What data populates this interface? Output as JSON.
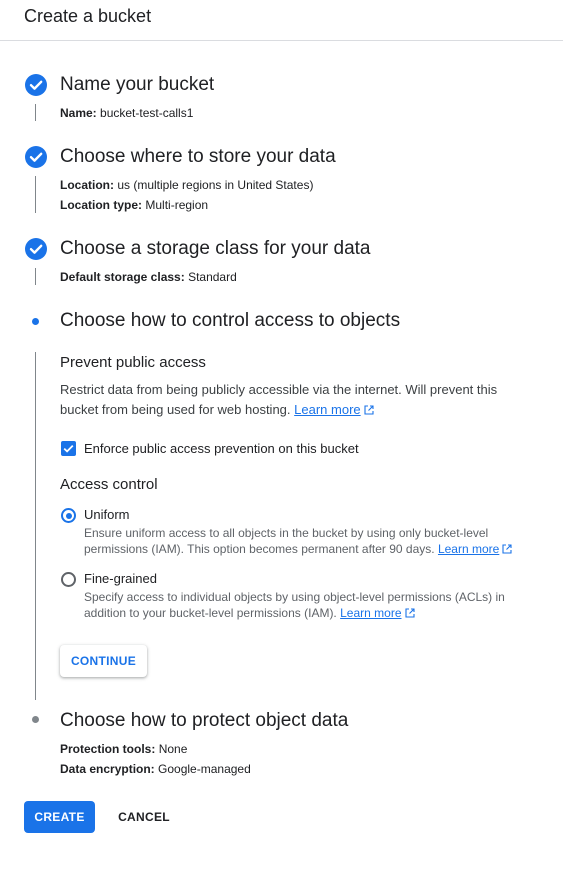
{
  "header": {
    "title": "Create a bucket"
  },
  "steps": [
    {
      "title": "Name your bucket",
      "status": "done",
      "details": [
        {
          "label": "Name:",
          "value": "bucket-test-calls1"
        }
      ]
    },
    {
      "title": "Choose where to store your data",
      "status": "done",
      "details": [
        {
          "label": "Location:",
          "value": "us (multiple regions in United States)"
        },
        {
          "label": "Location type:",
          "value": "Multi-region"
        }
      ]
    },
    {
      "title": "Choose a storage class for your data",
      "status": "done",
      "details": [
        {
          "label": "Default storage class:",
          "value": "Standard"
        }
      ]
    },
    {
      "title": "Choose how to control access to objects",
      "status": "active"
    },
    {
      "title": "Choose how to protect object data",
      "status": "pending",
      "details": [
        {
          "label": "Protection tools:",
          "value": "None"
        },
        {
          "label": "Data encryption:",
          "value": "Google-managed"
        }
      ]
    }
  ],
  "prevent_public_access": {
    "title": "Prevent public access",
    "description": "Restrict data from being publicly accessible via the internet. Will prevent this bucket from being used for web hosting.",
    "learn_more": "Learn more",
    "checkbox_label": "Enforce public access prevention on this bucket",
    "checkbox_checked": true
  },
  "access_control": {
    "title": "Access control",
    "selected": "Uniform",
    "options": [
      {
        "label": "Uniform",
        "description": "Ensure uniform access to all objects in the bucket by using only bucket-level permissions (IAM). This option becomes permanent after 90 days.",
        "learn_more": "Learn more"
      },
      {
        "label": "Fine-grained",
        "description": "Specify access to individual objects by using object-level permissions (ACLs) in addition to your bucket-level permissions (IAM).",
        "learn_more": "Learn more"
      }
    ]
  },
  "buttons": {
    "continue": "CONTINUE",
    "create": "CREATE",
    "cancel": "CANCEL"
  },
  "colors": {
    "accent": "#1a73e8",
    "text": "#202124",
    "secondary_text": "#5f6368",
    "divider": "#dadce0"
  },
  "icons": {
    "done": "check-circle-icon",
    "external": "open-in-new-icon"
  }
}
